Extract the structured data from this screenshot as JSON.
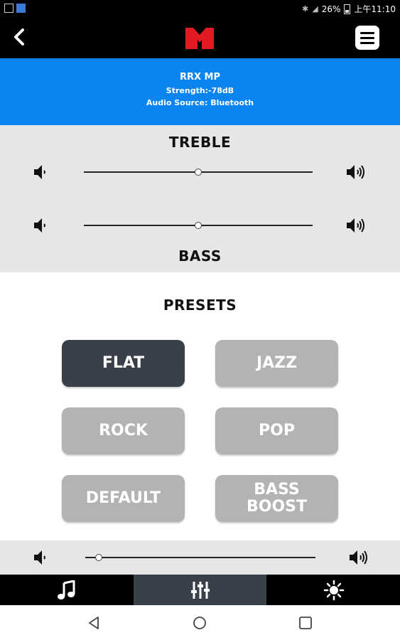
{
  "status_bar": {
    "battery": "26%",
    "time": "上午11:10"
  },
  "header": {
    "back_icon": "back-arrow-icon",
    "logo": "monster-m-logo",
    "menu_icon": "hamburger-menu-icon"
  },
  "device": {
    "name": "RRX MP",
    "strength": "Strength:-78dB",
    "source": "Audio Source: Bluetooth"
  },
  "eq": {
    "treble_title": "TREBLE",
    "bass_title": "BASS",
    "treble_level": 0.5,
    "bass_level": 0.5
  },
  "presets": {
    "title": "PRESETS",
    "buttons": [
      {
        "label": "FLAT",
        "active": true
      },
      {
        "label": "JAZZ",
        "active": false
      },
      {
        "label": "ROCK",
        "active": false
      },
      {
        "label": "POP",
        "active": false
      },
      {
        "label": "DEFAULT",
        "active": false
      },
      {
        "label": "BASS BOOST",
        "active": false
      }
    ]
  },
  "volume": {
    "level": 0.06
  },
  "nav": {
    "tabs": [
      "music-note-icon",
      "equalizer-icon",
      "brightness-icon"
    ],
    "active_index": 1
  },
  "colors": {
    "banner_blue": "#0a84f0",
    "active_preset": "#3a4049",
    "inactive_preset": "#b3b3b3",
    "logo_red": "#e21b22"
  }
}
